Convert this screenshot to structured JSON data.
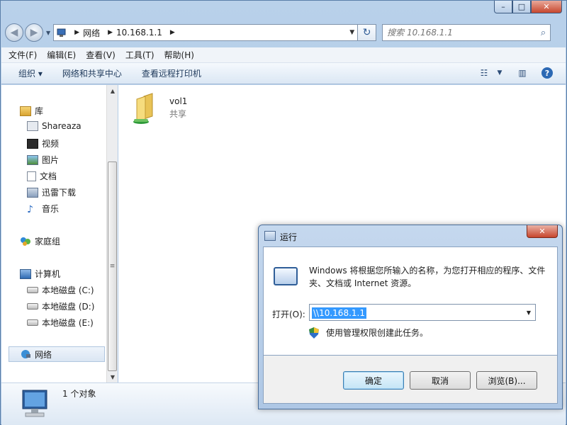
{
  "explorer": {
    "caption": {
      "minimize": "–",
      "maximize": "□",
      "close": "✕"
    },
    "nav": {
      "back": "◀",
      "forward": "▶"
    },
    "breadcrumb": [
      "网络",
      "10.168.1.1"
    ],
    "search": {
      "placeholder": "搜索 10.168.1.1"
    },
    "menu": [
      "文件(F)",
      "编辑(E)",
      "查看(V)",
      "工具(T)",
      "帮助(H)"
    ],
    "commands": [
      "组织 ▾",
      "网络和共享中心",
      "查看远程打印机"
    ],
    "help": "?",
    "tree": {
      "library": "库",
      "shareaza": "Shareaza",
      "videos": "视频",
      "pictures": "图片",
      "documents": "文档",
      "thunder": "迅雷下载",
      "music": "音乐",
      "homegroup": "家庭组",
      "computer": "计算机",
      "drive_c": "本地磁盘 (C:)",
      "drive_d": "本地磁盘 (D:)",
      "drive_e": "本地磁盘 (E:)",
      "network": "网络"
    },
    "share": {
      "name": "vol1",
      "type": "共享"
    },
    "details": {
      "count": "1 个对象"
    }
  },
  "run": {
    "title": "运行",
    "close": "✕",
    "description": "Windows 将根据您所输入的名称，为您打开相应的程序、文件夹、文档或 Internet 资源。",
    "open_label": "打开(O):",
    "open_value": "\\\\10.168.1.1",
    "admin_note": "使用管理权限创建此任务。",
    "buttons": {
      "ok": "确定",
      "cancel": "取消",
      "browse": "浏览(B)..."
    }
  },
  "colors": {
    "accent": "#3399ff",
    "frame": "#b9d1ea",
    "close": "#c7462d"
  },
  "icons": [
    "library-icon",
    "video-icon",
    "picture-icon",
    "document-icon",
    "download-icon",
    "music-icon",
    "homegroup-icon",
    "computer-icon",
    "drive-icon",
    "network-icon",
    "shared-folder-icon",
    "run-icon",
    "uac-shield-icon",
    "search-icon",
    "refresh-icon"
  ]
}
